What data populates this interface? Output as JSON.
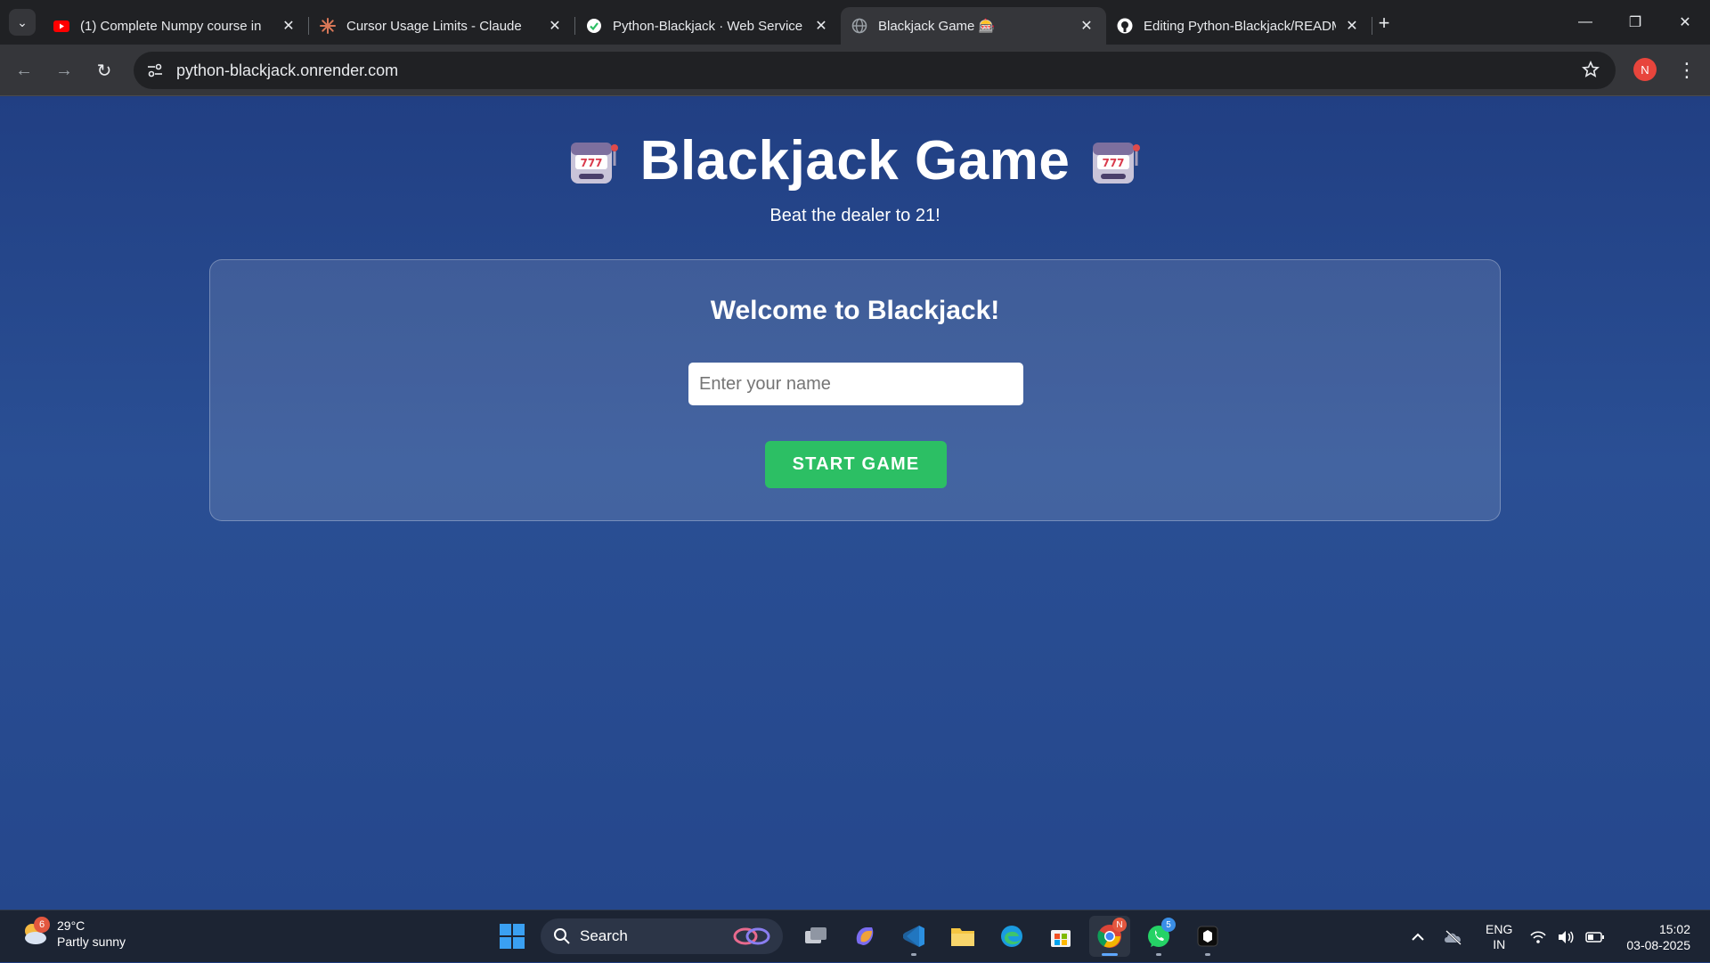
{
  "browser": {
    "tabs": [
      {
        "title": "(1) Complete Numpy course in",
        "favicon": "youtube-icon",
        "active": false
      },
      {
        "title": "Cursor Usage Limits - Claude",
        "favicon": "claude-icon",
        "active": false
      },
      {
        "title": "Python-Blackjack · Web Service",
        "favicon": "render-icon",
        "active": false
      },
      {
        "title": "Blackjack Game 🎰",
        "favicon": "globe-icon",
        "active": true
      },
      {
        "title": "Editing Python-Blackjack/READM",
        "favicon": "github-icon",
        "active": false
      }
    ],
    "url": "python-blackjack.onrender.com",
    "profile_initial": "N"
  },
  "page": {
    "title": "Blackjack Game",
    "title_emoji": "🎰",
    "subtitle": "Beat the dealer to 21!",
    "welcome_heading": "Welcome to Blackjack!",
    "name_input": {
      "value": "",
      "placeholder": "Enter your name"
    },
    "start_button": "START GAME",
    "colors": {
      "background": "#24468b",
      "start_button": "#2cbf64"
    }
  },
  "taskbar": {
    "weather": {
      "temp": "29°C",
      "condition": "Partly sunny",
      "badge": "6"
    },
    "search_label": "Search",
    "pinned_apps": [
      {
        "name": "task-view-icon"
      },
      {
        "name": "copilot-icon"
      },
      {
        "name": "vscode-icon"
      },
      {
        "name": "file-explorer-icon"
      },
      {
        "name": "edge-icon"
      },
      {
        "name": "microsoft-store-icon"
      },
      {
        "name": "chrome-icon",
        "badge": "N"
      },
      {
        "name": "whatsapp-icon",
        "badge": "5"
      },
      {
        "name": "terminal-app-icon"
      }
    ],
    "tray": {
      "language": "ENG",
      "region": "IN",
      "time": "15:02",
      "date": "03-08-2025"
    }
  }
}
